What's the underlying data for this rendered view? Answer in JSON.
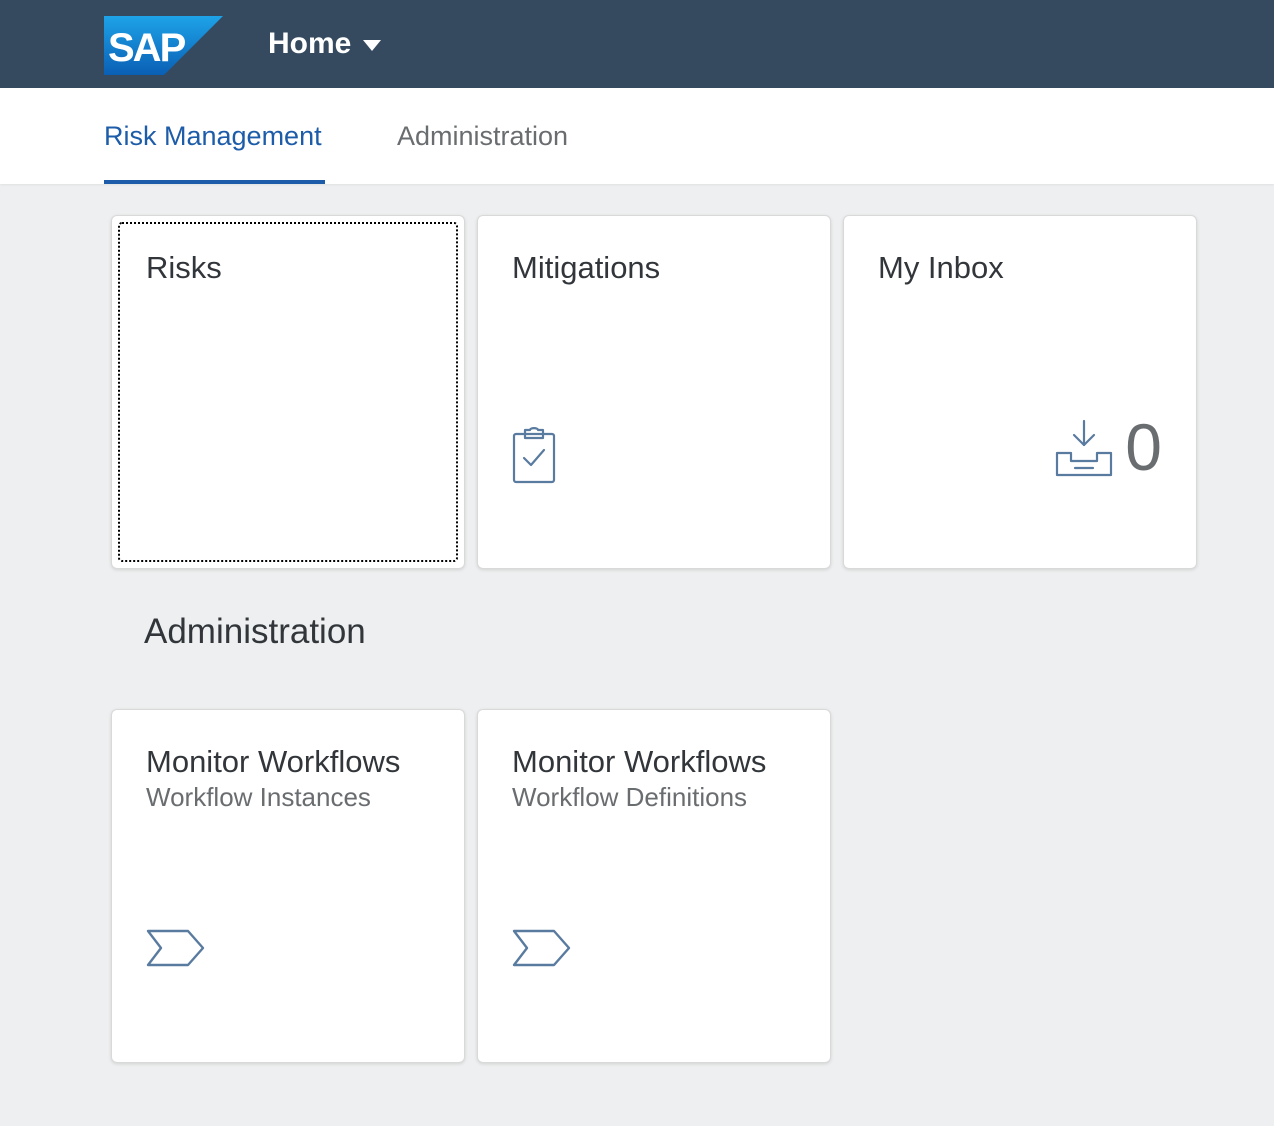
{
  "header": {
    "logo": "SAP",
    "title": "Home",
    "colors": {
      "background": "#354a5f",
      "logo": "#0b7bd3"
    }
  },
  "tabs": [
    {
      "label": "Risk Management",
      "active": true
    },
    {
      "label": "Administration",
      "active": false
    }
  ],
  "risk_group": {
    "tiles": [
      {
        "title": "Risks",
        "icon": ""
      },
      {
        "title": "Mitigations",
        "icon": "clipboard-check-icon"
      },
      {
        "title": "My Inbox",
        "icon": "inbox-download-icon",
        "count": "0"
      }
    ]
  },
  "admin_group": {
    "title": "Administration",
    "tiles": [
      {
        "title": "Monitor Workflows",
        "subtitle": "Workflow Instances",
        "icon": "process-chevron-icon"
      },
      {
        "title": "Monitor Workflows",
        "subtitle": "Workflow Definitions",
        "icon": "process-chevron-icon"
      }
    ]
  },
  "colors": {
    "accent": "#1d5ca8",
    "icon": "#5a7ba0",
    "page_background": "#edeff0"
  }
}
